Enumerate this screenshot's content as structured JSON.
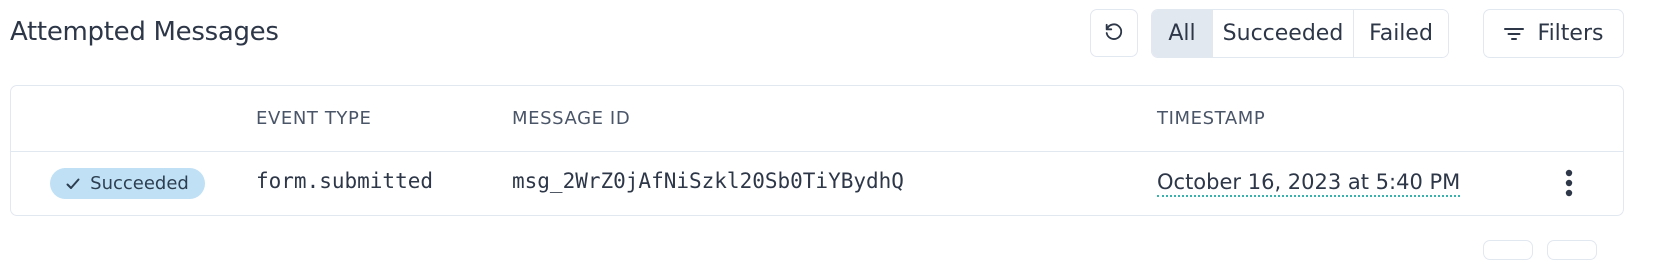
{
  "header": {
    "title": "Attempted Messages",
    "refresh_icon": "refresh-icon",
    "filter_tabs": [
      {
        "label": "All",
        "active": true
      },
      {
        "label": "Succeeded",
        "active": false
      },
      {
        "label": "Failed",
        "active": false
      }
    ],
    "filters_label": "Filters",
    "filters_icon": "filter-lines-icon"
  },
  "table": {
    "columns": [
      "",
      "EVENT TYPE",
      "MESSAGE ID",
      "TIMESTAMP",
      ""
    ],
    "rows": [
      {
        "status": "Succeeded",
        "status_icon": "check-icon",
        "event_type": "form.submitted",
        "message_id": "msg_2WrZ0jAfNiSzkl20Sb0TiYBydhQ",
        "timestamp": "October 16, 2023 at 5:40 PM",
        "menu_icon": "more-vertical-icon"
      }
    ]
  },
  "colors": {
    "border": "#e2e8f0",
    "active_tab_bg": "#e2e8f0",
    "badge_bg": "#bfe0f5",
    "timestamp_underline": "#38b2ac",
    "text": "#2d3748"
  }
}
